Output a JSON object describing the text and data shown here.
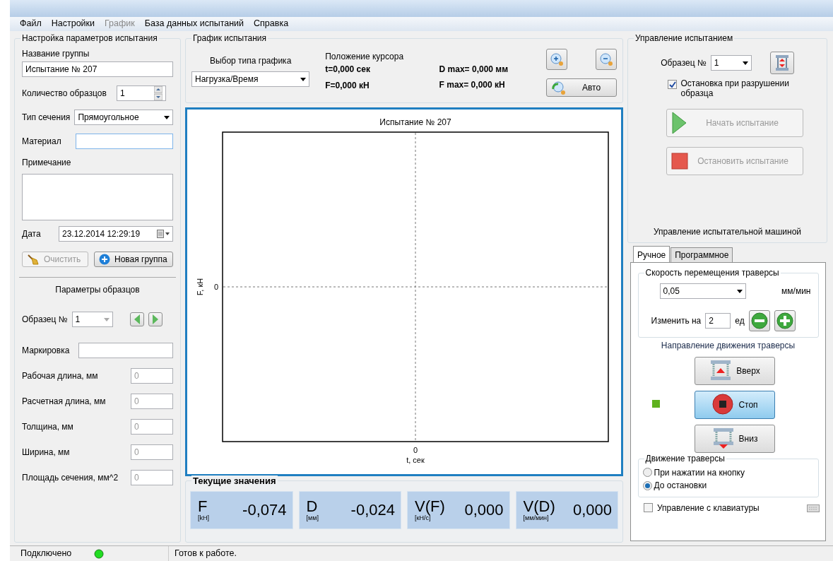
{
  "menu": [
    {
      "label": "Файл",
      "disabled": false
    },
    {
      "label": "Настройки",
      "disabled": false
    },
    {
      "label": "График",
      "disabled": true
    },
    {
      "label": "База данных испытаний",
      "disabled": false
    },
    {
      "label": "Справка",
      "disabled": false
    }
  ],
  "setup": {
    "title": "Настройка параметров испытания",
    "group_name": {
      "label": "Название группы",
      "value": "Испытание № 207"
    },
    "count": {
      "label": "Количество образцов",
      "value": "1"
    },
    "section_type": {
      "label": "Тип сечения",
      "value": "Прямоугольное"
    },
    "material": {
      "label": "Материал"
    },
    "note": {
      "label": "Примечание"
    },
    "date": {
      "label": "Дата",
      "value": "23.12.2014 12:29:19"
    },
    "clear_button": {
      "label": "Очистить",
      "disabled": true
    },
    "new_group_button": {
      "label": "Новая группа",
      "disabled": false
    },
    "samples_title": "Параметры образцов",
    "sample_no": {
      "label": "Образец №",
      "value": "1"
    },
    "marking": {
      "label": "Маркировка"
    },
    "params": [
      {
        "label": "Рабочая длина, мм",
        "placeholder": "0"
      },
      {
        "label": "Расчетная длина, мм",
        "placeholder": "0"
      },
      {
        "label": "Толщина, мм",
        "placeholder": "0"
      },
      {
        "label": "Ширина, мм",
        "placeholder": "0"
      },
      {
        "label": "Площадь сечения, мм^2",
        "placeholder": "0"
      }
    ]
  },
  "graph": {
    "title": "График испытания",
    "chart_type": {
      "label": "Выбор типа графика",
      "value": "Нагрузка/Время"
    },
    "cursor": {
      "title": "Положение курсора",
      "t": "t=0,000 сек",
      "f": "F=0,000 кН",
      "dmax": "D max= 0,000 мм",
      "fmax": "F max= 0,000 кН"
    },
    "auto_button": "Авто",
    "plot": {
      "title": "Испытание № 207",
      "xlabel": "t, сек",
      "ylabel": "F, кН",
      "x_origin_label": "0",
      "y_origin_label": "0"
    },
    "current": {
      "title": "Текущие значения",
      "items": [
        {
          "symbol": "F",
          "unit": "[kH]",
          "value": "-0,074"
        },
        {
          "symbol": "D",
          "unit": "[мм]",
          "value": "-0,024"
        },
        {
          "symbol": "V(F)",
          "unit": "[кН/с]",
          "value": "0,000"
        },
        {
          "symbol": "V(D)",
          "unit": "[мм/мин]",
          "value": "0,000"
        }
      ]
    }
  },
  "control": {
    "title": "Управление испытанием",
    "sample_no": {
      "label": "Образец №",
      "value": "1"
    },
    "stop_on_break": {
      "label": "Остановка при разрушении образца",
      "checked": true
    },
    "start_button": {
      "label": "Начать испытание",
      "disabled": true
    },
    "stop_button": {
      "label": "Остановить испытание",
      "disabled": true
    },
    "machine_title": "Управление испытательной машиной",
    "tabs": [
      {
        "label": "Ручное",
        "selected": true
      },
      {
        "label": "Программное",
        "selected": false
      }
    ],
    "speed": {
      "title": "Скорость перемещения траверсы",
      "value": "0,05",
      "unit": "мм/мин"
    },
    "change": {
      "label": "Изменить на",
      "value": "2",
      "unit": "ед"
    },
    "direction_title": "Направление движения траверсы",
    "direction_buttons": [
      {
        "kind": "up",
        "label": "Вверх",
        "selected": false
      },
      {
        "kind": "stop",
        "label": "Стоп",
        "selected": true
      },
      {
        "kind": "down",
        "label": "Вниз",
        "selected": false
      }
    ],
    "motion": {
      "title": "Движение траверсы",
      "options": [
        {
          "label": "При нажатии на кнопку",
          "selected": false
        },
        {
          "label": "До остановки",
          "selected": true
        }
      ]
    },
    "keyboard": {
      "label": "Управление с клавиатуры",
      "checked": false
    }
  },
  "status": {
    "connection": "Подключено",
    "connected": true,
    "message": "Готов к работе."
  }
}
